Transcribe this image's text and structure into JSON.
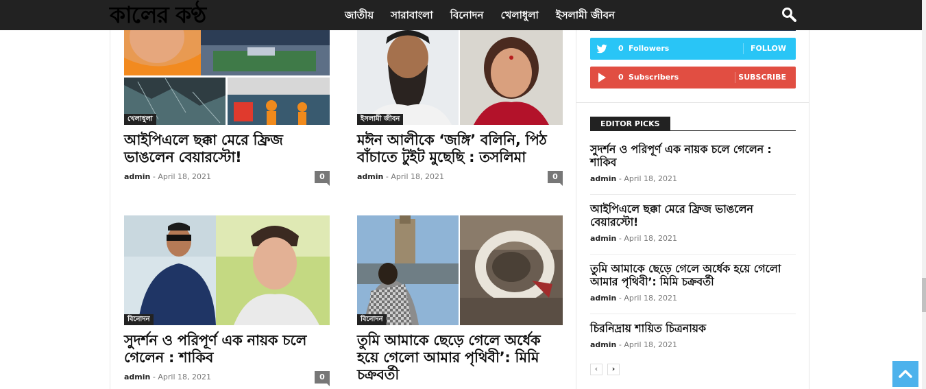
{
  "header": {
    "logo": "কালের কণ্ঠ",
    "nav": [
      "জাতীয়",
      "সারাবাংলা",
      "বিনোদন",
      "খেলাধুলা",
      "ইসলামী জীবন"
    ],
    "search_icon": "search-icon"
  },
  "articles": [
    {
      "category": "খেলাধুলা",
      "title": "আইপিএলে ছক্কা মেরে ফ্রিজ ভাঙলেন বেয়ারস্টো!",
      "author": "admin",
      "sep": "-",
      "date": "April 18, 2021",
      "comments": "0"
    },
    {
      "category": "ইসলামী জীবন",
      "title": "মঈন আলীকে ‘জঙ্গি’ বলিনি, পিঠ বাঁচাতে টুইট মুছেছি : তসলিমা",
      "author": "admin",
      "sep": "-",
      "date": "April 18, 2021",
      "comments": "0"
    },
    {
      "category": "বিনোদন",
      "title": "সুদর্শন ও পরিপূর্ণ এক নায়ক চলে গেলেন : শাকিব",
      "author": "admin",
      "sep": "-",
      "date": "April 18, 2021",
      "comments": "0"
    },
    {
      "category": "বিনোদন",
      "title": "তুমি আমাকে ছেড়ে গেলে অর্ধেক হয়ে গেলো আমার পৃথিবী’: মিমি চক্রবর্তী",
      "author": "admin",
      "sep": "-",
      "date": "April 18, 2021",
      "comments": "0"
    }
  ],
  "social": {
    "twitter": {
      "count": "0",
      "label": "Followers",
      "action": "FOLLOW",
      "color": "#29c5f6",
      "icon": "twitter-icon"
    },
    "youtube": {
      "count": "0",
      "label": "Subscribers",
      "action": "SUBSCRIBE",
      "color": "#e14e42",
      "icon": "youtube-icon"
    }
  },
  "editor_picks": {
    "heading": "EDITOR PICKS",
    "items": [
      {
        "title": "সুদর্শন ও পরিপূর্ণ এক নায়ক চলে গেলেন : শাকিব",
        "author": "admin",
        "sep": "-",
        "date": "April 18, 2021"
      },
      {
        "title": "আইপিএলে ছক্কা মেরে ফ্রিজ ভাঙলেন বেয়ারস্টো!",
        "author": "admin",
        "sep": "-",
        "date": "April 18, 2021"
      },
      {
        "title": "তুমি আমাকে ছেড়ে গেলে অর্ধেক হয়ে গেলো আমার পৃথিবী’: মিমি চক্রবর্তী",
        "author": "admin",
        "sep": "-",
        "date": "April 18, 2021"
      },
      {
        "title": "চিরনিদ্রায় শায়িত চিত্রনায়ক",
        "author": "admin",
        "sep": "-",
        "date": "April 18, 2021"
      }
    ],
    "prev": "‹",
    "next": "›"
  },
  "colors": {
    "topbar": "#222222",
    "accent": "#4db2ec"
  }
}
